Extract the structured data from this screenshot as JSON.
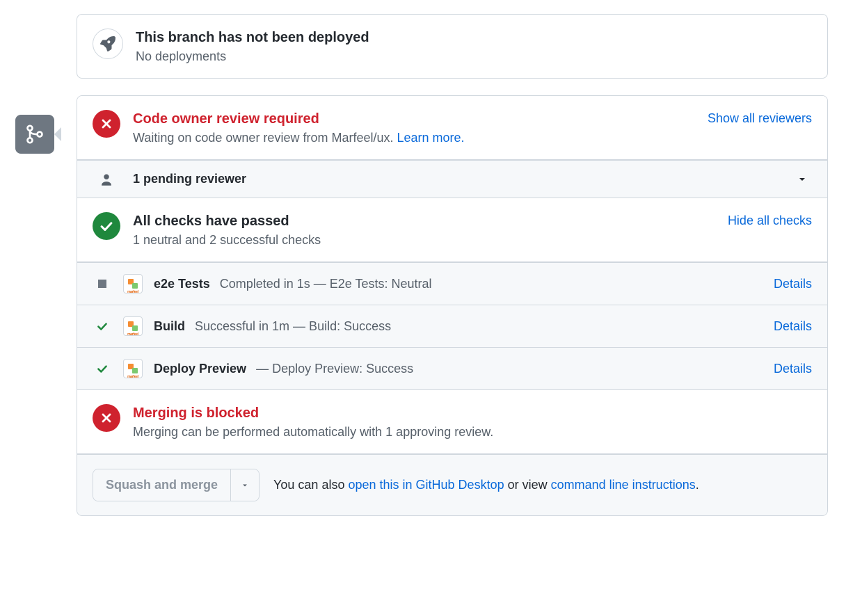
{
  "deployment": {
    "title": "This branch has not been deployed",
    "subtitle": "No deployments"
  },
  "review": {
    "title": "Code owner review required",
    "subtitle_prefix": "Waiting on code owner review from Marfeel/ux. ",
    "learn_more": "Learn more.",
    "show_all": "Show all reviewers"
  },
  "pending": {
    "text": "1 pending reviewer"
  },
  "checks": {
    "title": "All checks have passed",
    "subtitle": "1 neutral and 2 successful checks",
    "hide_all": "Hide all checks",
    "items": [
      {
        "name": "e2e Tests",
        "rest": "Completed in 1s — E2e Tests: Neutral",
        "details": "Details"
      },
      {
        "name": "Build",
        "rest": "Successful in 1m — Build: Success",
        "details": "Details"
      },
      {
        "name": "Deploy Preview",
        "rest": "— Deploy Preview: Success",
        "details": "Details"
      }
    ]
  },
  "blocked": {
    "title": "Merging is blocked",
    "subtitle": "Merging can be performed automatically with 1 approving review."
  },
  "footer": {
    "button": "Squash and merge",
    "text_prefix": "You can also ",
    "desktop": "open this in GitHub Desktop",
    "middle": " or view ",
    "cli": "command line instructions",
    "suffix": "."
  }
}
